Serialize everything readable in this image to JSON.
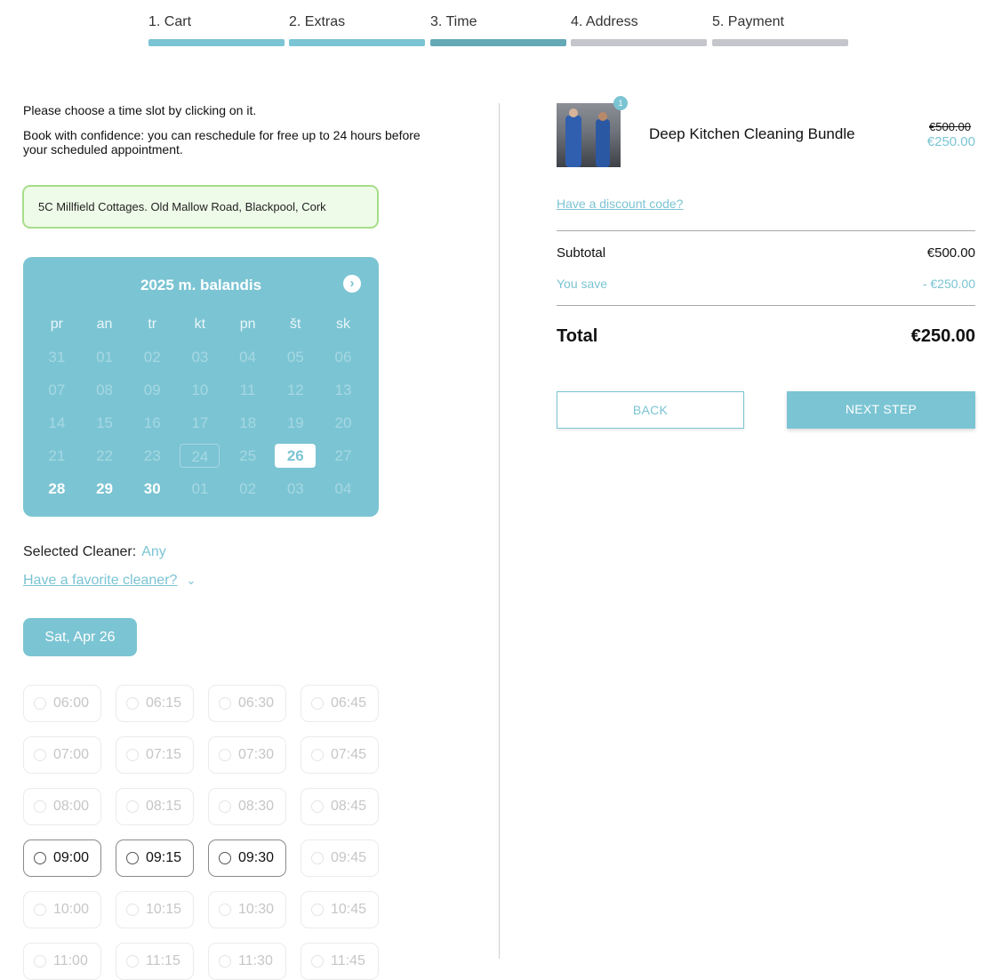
{
  "steps": [
    {
      "label": "1. Cart",
      "state": "done"
    },
    {
      "label": "2. Extras",
      "state": "done"
    },
    {
      "label": "3. Time",
      "state": "current"
    },
    {
      "label": "4. Address",
      "state": "todo"
    },
    {
      "label": "5. Payment",
      "state": "todo"
    }
  ],
  "intro": {
    "line1": "Please choose a time slot by clicking on it.",
    "line2": "Book with confidence: you can reschedule for free up to 24 hours before your scheduled appointment."
  },
  "address": "5C Millfield Cottages. Old Mallow Road, Blackpool, Cork",
  "calendar": {
    "title": "2025 m. balandis",
    "next_icon": "chevron-right-icon",
    "weekdays": [
      "pr",
      "an",
      "tr",
      "kt",
      "pn",
      "št",
      "sk"
    ],
    "weeks": [
      [
        {
          "d": "31"
        },
        {
          "d": "01"
        },
        {
          "d": "02"
        },
        {
          "d": "03"
        },
        {
          "d": "04"
        },
        {
          "d": "05"
        },
        {
          "d": "06"
        }
      ],
      [
        {
          "d": "07"
        },
        {
          "d": "08"
        },
        {
          "d": "09"
        },
        {
          "d": "10"
        },
        {
          "d": "11"
        },
        {
          "d": "12"
        },
        {
          "d": "13"
        }
      ],
      [
        {
          "d": "14"
        },
        {
          "d": "15"
        },
        {
          "d": "16"
        },
        {
          "d": "17"
        },
        {
          "d": "18"
        },
        {
          "d": "19"
        },
        {
          "d": "20"
        }
      ],
      [
        {
          "d": "21"
        },
        {
          "d": "22"
        },
        {
          "d": "23"
        },
        {
          "d": "24",
          "s": "today"
        },
        {
          "d": "25"
        },
        {
          "d": "26",
          "s": "selected"
        },
        {
          "d": "27"
        }
      ],
      [
        {
          "d": "28",
          "s": "active"
        },
        {
          "d": "29",
          "s": "active"
        },
        {
          "d": "30",
          "s": "active"
        },
        {
          "d": "01"
        },
        {
          "d": "02"
        },
        {
          "d": "03"
        },
        {
          "d": "04"
        }
      ]
    ]
  },
  "cleaner": {
    "label": "Selected Cleaner:",
    "value": "Any",
    "favorite_link": "Have a favorite cleaner?"
  },
  "selected_date": "Sat, Apr 26",
  "slots": [
    {
      "t": "06:00",
      "a": false
    },
    {
      "t": "06:15",
      "a": false
    },
    {
      "t": "06:30",
      "a": false
    },
    {
      "t": "06:45",
      "a": false
    },
    {
      "t": "07:00",
      "a": false
    },
    {
      "t": "07:15",
      "a": false
    },
    {
      "t": "07:30",
      "a": false
    },
    {
      "t": "07:45",
      "a": false
    },
    {
      "t": "08:00",
      "a": false
    },
    {
      "t": "08:15",
      "a": false
    },
    {
      "t": "08:30",
      "a": false
    },
    {
      "t": "08:45",
      "a": false
    },
    {
      "t": "09:00",
      "a": true
    },
    {
      "t": "09:15",
      "a": true
    },
    {
      "t": "09:30",
      "a": true
    },
    {
      "t": "09:45",
      "a": false
    },
    {
      "t": "10:00",
      "a": false
    },
    {
      "t": "10:15",
      "a": false
    },
    {
      "t": "10:30",
      "a": false
    },
    {
      "t": "10:45",
      "a": false
    },
    {
      "t": "11:00",
      "a": false
    },
    {
      "t": "11:15",
      "a": false
    },
    {
      "t": "11:30",
      "a": false
    },
    {
      "t": "11:45",
      "a": false
    }
  ],
  "cart": {
    "badge_count": "1",
    "product_name": "Deep Kitchen Cleaning Bundle",
    "old_price": "€500.00",
    "new_price": "€250.00",
    "discount_link": "Have a discount code?",
    "subtotal_label": "Subtotal",
    "subtotal_value": "€500.00",
    "save_label": "You save",
    "save_value": "- €250.00",
    "total_label": "Total",
    "total_value": "€250.00"
  },
  "buttons": {
    "back": "BACK",
    "next": "NEXT STEP"
  },
  "colors": {
    "accent": "#7bc4d3",
    "accent_dark": "#63a9b6",
    "address_border": "#a6de8a",
    "address_bg": "#effbe9"
  }
}
